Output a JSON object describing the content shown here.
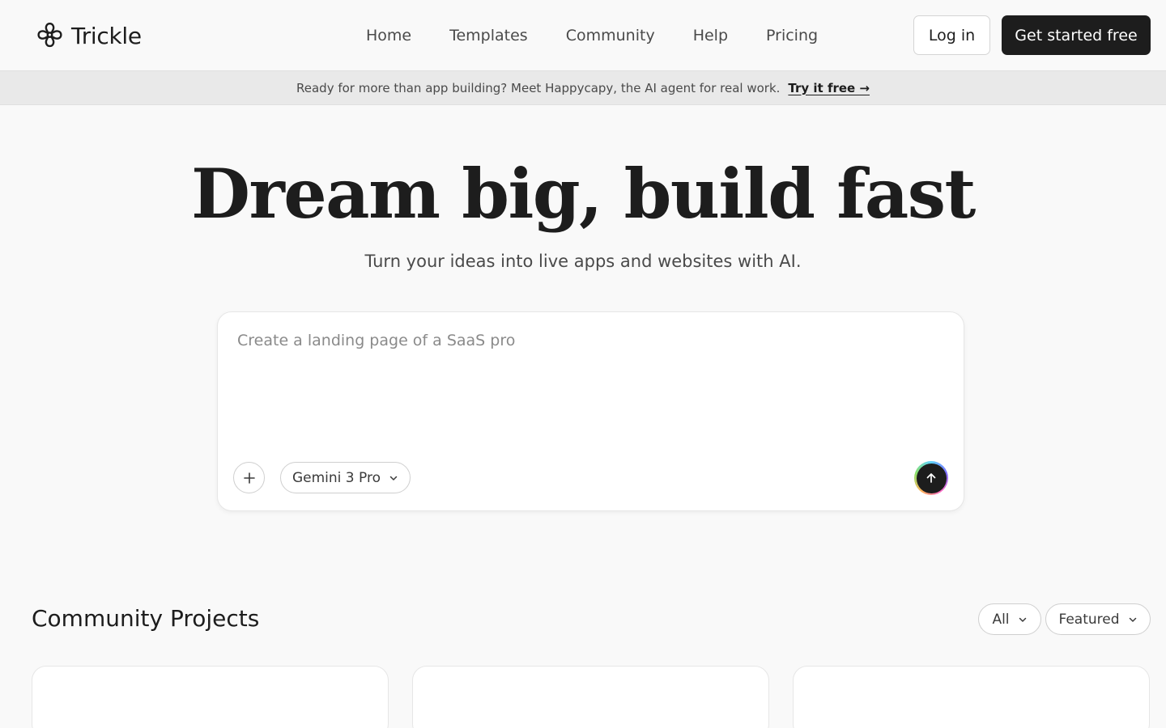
{
  "brand": {
    "name": "Trickle",
    "logo_icon": "trickle-logo-icon"
  },
  "nav": {
    "items": [
      {
        "label": "Home"
      },
      {
        "label": "Templates"
      },
      {
        "label": "Community"
      },
      {
        "label": "Help"
      },
      {
        "label": "Pricing"
      }
    ]
  },
  "auth": {
    "login_label": "Log in",
    "signup_label": "Get started free"
  },
  "banner": {
    "text": "Ready for more than app building? Meet Happycapy, the AI agent for real work.",
    "link_label": "Try it free →"
  },
  "hero": {
    "title": "Dream big, build fast",
    "subtitle": "Turn your ideas into live apps and websites with AI."
  },
  "prompt": {
    "placeholder": "Create a landing page of a SaaS pro",
    "value": "",
    "model_label": "Gemini 3 Pro",
    "add_icon": "plus-icon",
    "send_icon": "arrow-up-icon"
  },
  "community": {
    "title": "Community Projects",
    "filters": [
      {
        "label": "All"
      },
      {
        "label": "Featured"
      }
    ]
  },
  "colors": {
    "background": "#f9f9f9",
    "primary_dark": "#1d1d1d",
    "banner_bg": "#e9e9e9",
    "muted_text": "#4a4a4a",
    "card_bg": "#ffffff"
  }
}
